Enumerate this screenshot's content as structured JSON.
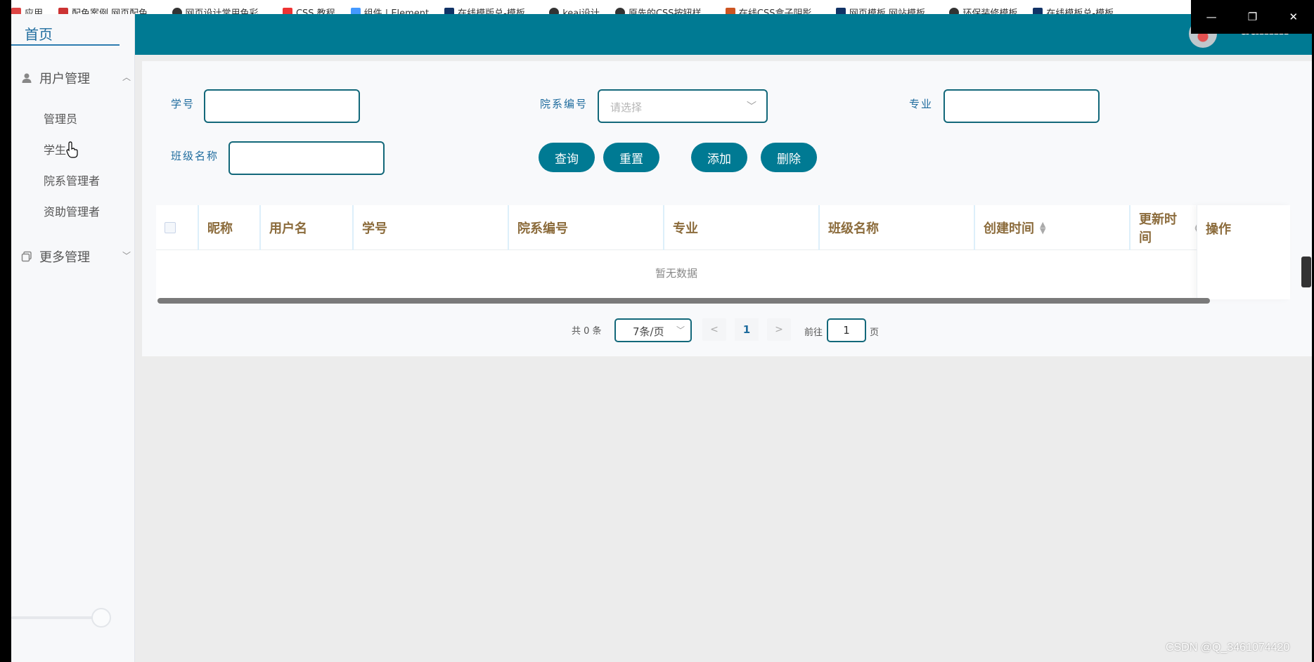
{
  "bookmarks": [
    {
      "label": "应用",
      "icon": "apps-grid-icon",
      "color": "#d44"
    },
    {
      "label": "配色案例,网页配色...",
      "icon": "bookmark-favicon",
      "color": "#c33"
    },
    {
      "label": "网页设计常用色彩...",
      "icon": "globe-icon",
      "color": "#333"
    },
    {
      "label": "CSS 教程",
      "icon": "css-icon",
      "color": "#e33"
    },
    {
      "label": "组件 | Element",
      "icon": "element-icon",
      "color": "#49f"
    },
    {
      "label": "在线模版总-模板...",
      "icon": "template-icon",
      "color": "#136"
    },
    {
      "label": "keai设计",
      "icon": "globe-icon",
      "color": "#333"
    },
    {
      "label": "原先的CSS按钮样...",
      "icon": "search-icon",
      "color": "#333"
    },
    {
      "label": "在线CSS盒子阴影...",
      "icon": "css-box-icon",
      "color": "#c52"
    },
    {
      "label": "网页模板,网站模板...",
      "icon": "template-icon",
      "color": "#136"
    },
    {
      "label": "环保装修模板",
      "icon": "globe-icon",
      "color": "#333"
    },
    {
      "label": "在线模板总-模板...",
      "icon": "template-icon",
      "color": "#136"
    }
  ],
  "header": {
    "username": "admin"
  },
  "sidebar": {
    "home": "首页",
    "groups": [
      {
        "label": "用户管理",
        "icon": "user-icon",
        "expanded": true,
        "items": [
          "管理员",
          "学生",
          "院系管理者",
          "资助管理者"
        ]
      },
      {
        "label": "更多管理",
        "icon": "copy-icon",
        "expanded": false,
        "items": []
      }
    ]
  },
  "search": {
    "student_id_label": "学号",
    "dept_code_label": "院系编号",
    "dept_code_placeholder": "请选择",
    "major_label": "专业",
    "class_name_label": "班级名称",
    "student_id_value": "",
    "major_value": "",
    "class_name_value": ""
  },
  "actions": {
    "query": "查询",
    "reset": "重置",
    "add": "添加",
    "delete": "删除"
  },
  "table": {
    "columns": [
      "昵称",
      "用户名",
      "学号",
      "院系编号",
      "专业",
      "班级名称",
      "创建时间",
      "更新时间",
      "操作"
    ],
    "sortable": [
      "创建时间",
      "更新时间"
    ],
    "rows": [],
    "empty_text": "暂无数据"
  },
  "pagination": {
    "total_text": "共 0 条",
    "page_size": "7条/页",
    "current_page": "1",
    "goto_label": "前往",
    "goto_value": "1",
    "page_suffix": "页"
  },
  "colors": {
    "primary": "#007a93",
    "header_text": "#8b6b3b",
    "label": "#1f6c9e"
  },
  "watermark": "CSDN @Q_3461074420"
}
